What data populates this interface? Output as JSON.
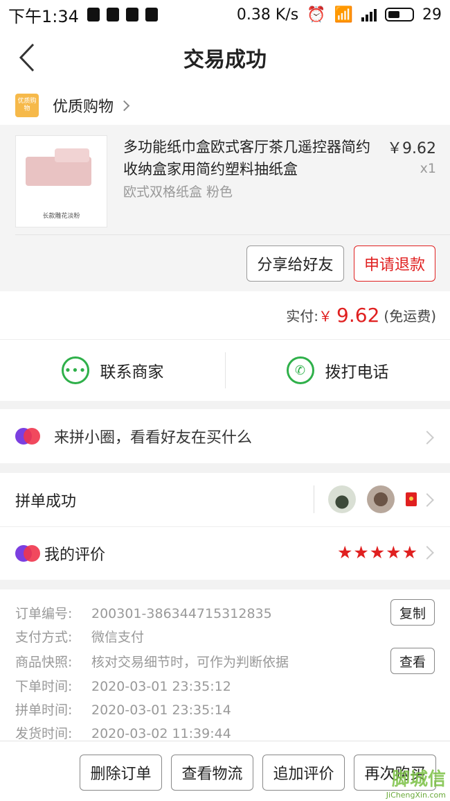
{
  "status_bar": {
    "time": "下午1:34",
    "net_speed": "0.38 K/s",
    "battery": "29"
  },
  "header": {
    "title": "交易成功"
  },
  "shop": {
    "logo_text": "优质购物",
    "name": "优质购物"
  },
  "product": {
    "title": "多功能纸巾盒欧式客厅茶几遥控器简约收纳盒家用简约塑料抽纸盒",
    "spec": "欧式双格纸盒 粉色",
    "price": "￥9.62",
    "quantity": "x1",
    "thumb_caption": "长款雕花淡粉"
  },
  "product_actions": {
    "share": "分享给好友",
    "refund": "申请退款"
  },
  "payment": {
    "label": "实付:",
    "currency": "￥",
    "amount": "9.62",
    "shipping": "(免运费)"
  },
  "contact": {
    "merchant": "联系商家",
    "phone": "拨打电话"
  },
  "circle": {
    "text": "来拼小圈，看看好友在买什么"
  },
  "group": {
    "label": "拼单成功"
  },
  "review": {
    "label": "我的评价",
    "rating": 5,
    "stars": "★★★★★"
  },
  "order_info": {
    "order_no_label": "订单编号:",
    "order_no": "200301-386344715312835",
    "payment_method_label": "支付方式:",
    "payment_method": "微信支付",
    "snapshot_label": "商品快照:",
    "snapshot": "核对交易细节时，可作为判断依据",
    "order_time_label": "下单时间:",
    "order_time": "2020-03-01 23:35:12",
    "group_time_label": "拼单时间:",
    "group_time": "2020-03-01 23:35:14",
    "ship_time_label": "发货时间:",
    "ship_time": "2020-03-02 11:39:44",
    "copy_button": "复制",
    "view_button": "查看"
  },
  "bottom_actions": {
    "delete": "删除订单",
    "logistics": "查看物流",
    "add_review": "追加评价",
    "rebuy": "再次购买"
  },
  "watermark": {
    "line1": "脚城信",
    "line2": "JiChengXin.com"
  },
  "colors": {
    "accent_red": "#e02020",
    "green": "#2fb04a",
    "purple": "#7b3fe0"
  }
}
